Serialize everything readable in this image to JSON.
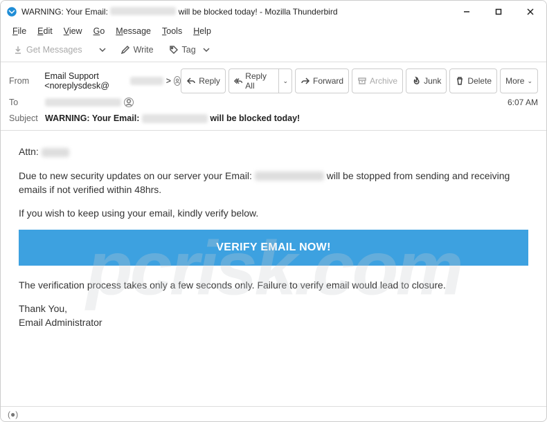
{
  "window": {
    "title": "WARNING: Your Email: [redacted] will be blocked today! - Mozilla Thunderbird"
  },
  "menubar": {
    "items": [
      "File",
      "Edit",
      "View",
      "Go",
      "Message",
      "Tools",
      "Help"
    ]
  },
  "toolbar": {
    "get_messages": "Get Messages",
    "write": "Write",
    "tag": "Tag"
  },
  "header": {
    "from_label": "From",
    "from_value": "Email Support <noreplysdesk@",
    "from_value_suffix": ">",
    "to_label": "To",
    "subject_label": "Subject",
    "subject_prefix": "WARNING: Your Email:",
    "subject_suffix": "will be blocked today!",
    "time": "6:07 AM",
    "actions": {
      "reply": "Reply",
      "reply_all": "Reply All",
      "forward": "Forward",
      "archive": "Archive",
      "junk": "Junk",
      "delete": "Delete",
      "more": "More"
    }
  },
  "body": {
    "attn": "Attn:",
    "p1_a": "Due to new security updates on our server your Email:",
    "p1_b": "will be stopped from sending and receiving emails if not verified within 48hrs.",
    "p2": "If you wish to keep using your email, kindly verify below.",
    "verify_button": "VERIFY EMAIL NOW!",
    "p3": "The verification process takes only a few seconds only. Failure to verify email would lead to closure.",
    "signoff1": "Thank You,",
    "signoff2": "Email Administrator"
  },
  "watermark": "pcrisk.com"
}
